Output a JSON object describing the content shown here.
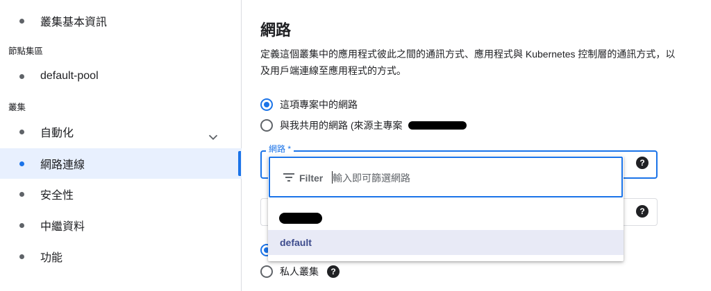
{
  "sidebar": {
    "top_item": "叢集基本資訊",
    "section_nodepool": "節點集區",
    "nodepool_item": "default-pool",
    "section_cluster": "叢集",
    "items": [
      {
        "label": "自動化"
      },
      {
        "label": "網路連線"
      },
      {
        "label": "安全性"
      },
      {
        "label": "中繼資料"
      },
      {
        "label": "功能"
      }
    ],
    "active_item": "網路連線"
  },
  "main": {
    "title": "網路",
    "description": "定義這個叢集中的應用程式彼此之間的通訊方式、應用程式與 Kubernetes 控制層的通訊方式，以及用戶端連線至應用程式的方式。",
    "network_options": [
      {
        "label": "這項專案中的網路",
        "selected": true
      },
      {
        "label": "與我共用的網路 (來源主專案",
        "selected": false
      }
    ],
    "network_field_label": "網路 *",
    "private_cluster_label": "私人叢集"
  },
  "dropdown": {
    "filter_label": "Filter",
    "filter_placeholder": "輸入即可篩選網路",
    "options": [
      {
        "label": "",
        "redacted": true
      },
      {
        "label": "default",
        "highlighted": true
      }
    ]
  },
  "icons": {
    "help": "?"
  },
  "colors": {
    "accent": "#1a73e8",
    "active_bg": "#e8f0fe",
    "option_highlight": "#e8eaf6"
  }
}
